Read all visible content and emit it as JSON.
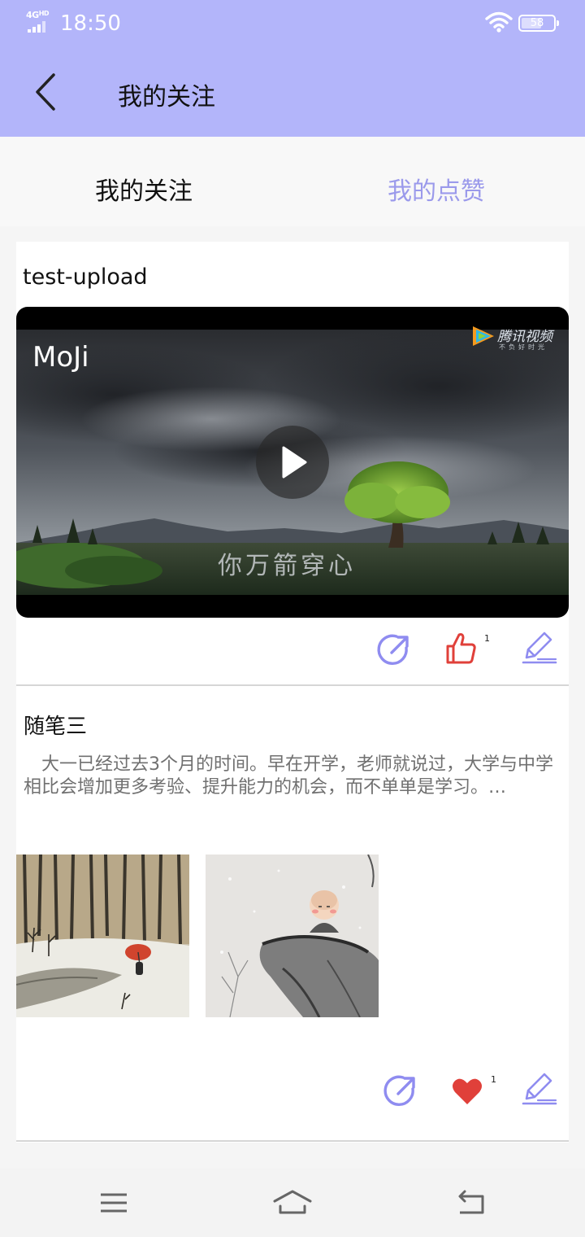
{
  "status_bar": {
    "network": "4G",
    "network_sup": "HD",
    "time": "18:50",
    "battery": "58"
  },
  "app_bar": {
    "title": "我的关注",
    "back_icon": "chevron-left-icon"
  },
  "tabs": [
    {
      "label": "我的关注",
      "active": true
    },
    {
      "label": "我的点赞",
      "active": false
    }
  ],
  "posts": [
    {
      "title": "test-upload",
      "media": {
        "type": "video",
        "overlay_title": "MoJi",
        "watermark": "腾讯视频",
        "watermark_sub": "不负好时光",
        "subtitle": "你万箭穿心"
      },
      "like_icon": "thumbs-up-icon",
      "like_count": "1"
    },
    {
      "title": "随笔三",
      "excerpt": "　大一已经过去3个月的时间。早在开学，老师就说过，大学与中学相比会增加更多考验、提升能力的机会，而不单单是学习。…",
      "like_icon": "heart-icon",
      "like_count": "1"
    }
  ],
  "colors": {
    "accent": "#b3b5fa",
    "tab_inactive": "#9b9aeb",
    "icon_purple": "#8f8cf0",
    "like_red": "#e0403a"
  },
  "nav_bar": [
    "menu-icon",
    "home-icon",
    "back-icon"
  ]
}
